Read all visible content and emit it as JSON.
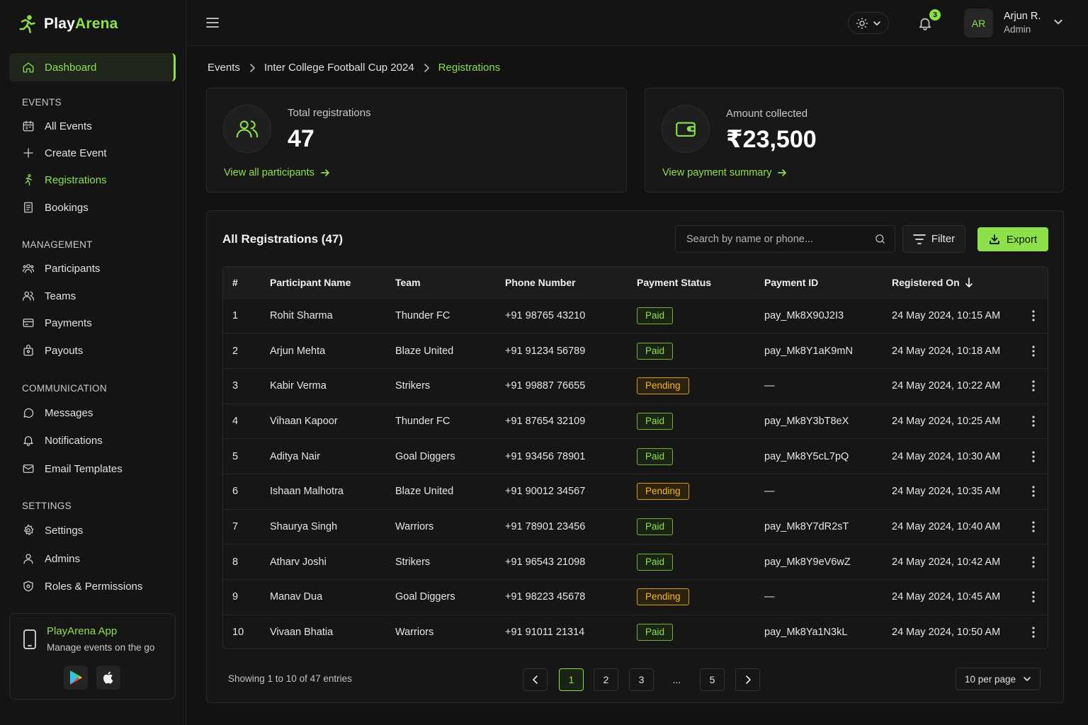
{
  "brand": {
    "name_part1": "Play",
    "name_part2": "Arena",
    "accent": "#8ee04a"
  },
  "sidebar": {
    "dashboard": "Dashboard",
    "sections": {
      "events": "EVENTS",
      "management": "MANAGEMENT",
      "communication": "COMMUNICATION",
      "settings": "SETTINGS"
    },
    "items": {
      "all_events": "All Events",
      "create_event": "Create Event",
      "registrations": "Registrations",
      "bookings": "Bookings",
      "participants": "Participants",
      "teams": "Teams",
      "payments": "Payments",
      "payouts": "Payouts",
      "messages": "Messages",
      "notifications": "Notifications",
      "email_templates": "Email Templates",
      "settings": "Settings",
      "admins": "Admins",
      "roles": "Roles & Permissions"
    },
    "app_card": {
      "title": "PlayArena App",
      "subtitle": "Manage events on the go"
    }
  },
  "topbar": {
    "notification_count": "3",
    "user": {
      "initials": "AR",
      "name": "Arjun R.",
      "role": "Admin"
    }
  },
  "breadcrumb": [
    "Events",
    "Inter College Football Cup 2024",
    "Registrations"
  ],
  "stats": {
    "registrations": {
      "label": "Total registrations",
      "value": "47",
      "link": "View all participants"
    },
    "amount": {
      "label": "Amount collected",
      "value": "₹23,500",
      "link": "View payment summary"
    }
  },
  "table": {
    "title": "All Registrations (47)",
    "search_placeholder": "Search by name or phone...",
    "filter_label": "Filter",
    "export_label": "Export",
    "columns": [
      "#",
      "Participant Name",
      "Team",
      "Phone Number",
      "Payment Status",
      "Payment ID",
      "Registered On"
    ],
    "rows": [
      [
        "1",
        "Rohit Sharma",
        "Thunder FC",
        "+91 98765 43210",
        "Paid",
        "pay_Mk8X90J2I3",
        "24 May 2024, 10:15 AM"
      ],
      [
        "2",
        "Arjun Mehta",
        "Blaze United",
        "+91 91234 56789",
        "Paid",
        "pay_Mk8Y1aK9mN",
        "24 May 2024, 10:18 AM"
      ],
      [
        "3",
        "Kabir Verma",
        "Strikers",
        "+91 99887 76655",
        "Pending",
        "—",
        "24 May 2024, 10:22 AM"
      ],
      [
        "4",
        "Vihaan Kapoor",
        "Thunder FC",
        "+91 87654 32109",
        "Paid",
        "pay_Mk8Y3bT8eX",
        "24 May 2024, 10:25 AM"
      ],
      [
        "5",
        "Aditya Nair",
        "Goal Diggers",
        "+91 93456 78901",
        "Paid",
        "pay_Mk8Y5cL7pQ",
        "24 May 2024, 10:30 AM"
      ],
      [
        "6",
        "Ishaan Malhotra",
        "Blaze United",
        "+91 90012 34567",
        "Pending",
        "—",
        "24 May 2024, 10:35 AM"
      ],
      [
        "7",
        "Shaurya Singh",
        "Warriors",
        "+91 78901 23456",
        "Paid",
        "pay_Mk8Y7dR2sT",
        "24 May 2024, 10:40 AM"
      ],
      [
        "8",
        "Atharv Joshi",
        "Strikers",
        "+91 96543 21098",
        "Paid",
        "pay_Mk8Y9eV6wZ",
        "24 May 2024, 10:42 AM"
      ],
      [
        "9",
        "Manav Dua",
        "Goal Diggers",
        "+91 98223 45678",
        "Pending",
        "—",
        "24 May 2024, 10:45 AM"
      ],
      [
        "10",
        "Vivaan Bhatia",
        "Warriors",
        "+91 91011 21314",
        "Paid",
        "pay_Mk8Ya1N3kL",
        "24 May 2024, 10:50 AM"
      ]
    ]
  },
  "pagination": {
    "showing": "Showing 1 to 10 of 47 entries",
    "pages": [
      "1",
      "2",
      "3",
      "...",
      "5"
    ],
    "current": "1",
    "per_page": "10 per page"
  },
  "colors": {
    "paid": "#8ee04a",
    "pending": "#f5b72e"
  }
}
